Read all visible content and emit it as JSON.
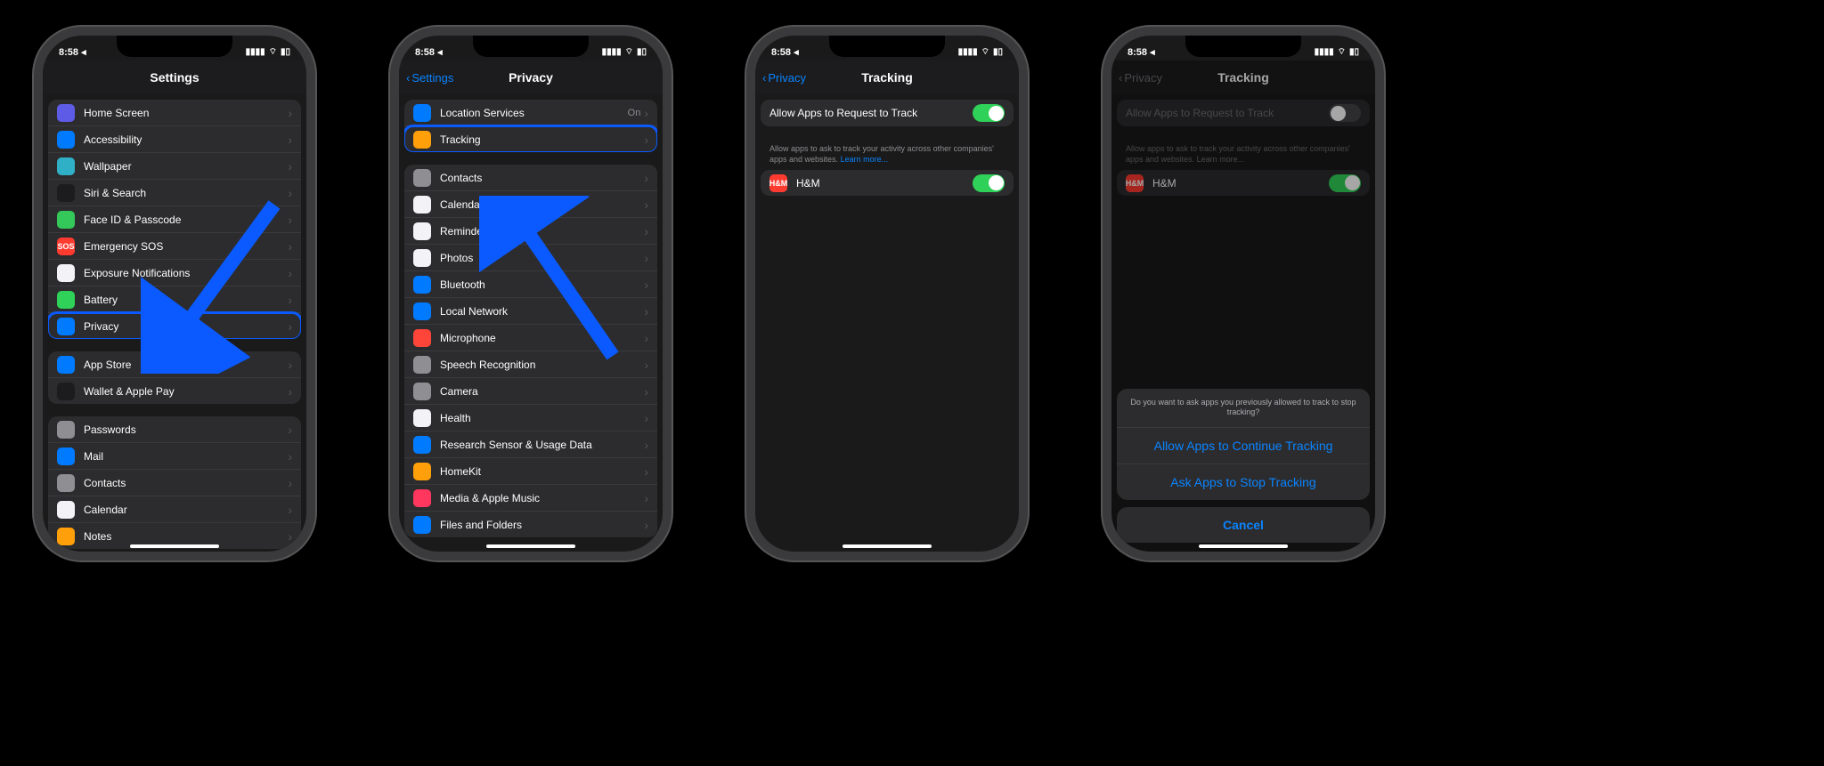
{
  "status": {
    "time": "8:58",
    "indicator": "◂"
  },
  "screen1": {
    "title": "Settings",
    "items": [
      {
        "label": "Home Screen",
        "icon_name": "home-screen-icon",
        "icon_class": "i-purple"
      },
      {
        "label": "Accessibility",
        "icon_name": "accessibility-icon",
        "icon_class": "i-blue2"
      },
      {
        "label": "Wallpaper",
        "icon_name": "wallpaper-icon",
        "icon_class": "i-teal"
      },
      {
        "label": "Siri & Search",
        "icon_name": "siri-icon",
        "icon_class": "i-dark"
      },
      {
        "label": "Face ID & Passcode",
        "icon_name": "faceid-icon",
        "icon_class": "i-green"
      },
      {
        "label": "Emergency SOS",
        "icon_name": "sos-icon",
        "icon_class": "i-red",
        "icon_text": "SOS"
      },
      {
        "label": "Exposure Notifications",
        "icon_name": "exposure-icon",
        "icon_class": "i-white"
      },
      {
        "label": "Battery",
        "icon_name": "battery-icon",
        "icon_class": "i-green2"
      },
      {
        "label": "Privacy",
        "icon_name": "privacy-icon",
        "icon_class": "i-blue2",
        "highlight": true
      }
    ],
    "group2": [
      {
        "label": "App Store",
        "icon_name": "appstore-icon",
        "icon_class": "i-blue2"
      },
      {
        "label": "Wallet & Apple Pay",
        "icon_name": "wallet-icon",
        "icon_class": "i-dark"
      }
    ],
    "group3": [
      {
        "label": "Passwords",
        "icon_name": "passwords-icon",
        "icon_class": "i-gray"
      },
      {
        "label": "Mail",
        "icon_name": "mail-icon",
        "icon_class": "i-blue2"
      },
      {
        "label": "Contacts",
        "icon_name": "contacts-icon",
        "icon_class": "i-gray"
      },
      {
        "label": "Calendar",
        "icon_name": "calendar-icon",
        "icon_class": "i-white"
      },
      {
        "label": "Notes",
        "icon_name": "notes-icon",
        "icon_class": "i-orange"
      }
    ]
  },
  "screen2": {
    "title": "Privacy",
    "back": "Settings",
    "top": [
      {
        "label": "Location Services",
        "icon_name": "location-icon",
        "icon_class": "i-blue2",
        "value": "On"
      },
      {
        "label": "Tracking",
        "icon_name": "tracking-icon",
        "icon_class": "i-orange",
        "highlight": true
      }
    ],
    "items": [
      {
        "label": "Contacts",
        "icon_name": "contacts-icon",
        "icon_class": "i-gray"
      },
      {
        "label": "Calendars",
        "icon_name": "calendars-icon",
        "icon_class": "i-white"
      },
      {
        "label": "Reminders",
        "icon_name": "reminders-icon",
        "icon_class": "i-white"
      },
      {
        "label": "Photos",
        "icon_name": "photos-icon",
        "icon_class": "i-white"
      },
      {
        "label": "Bluetooth",
        "icon_name": "bluetooth-icon",
        "icon_class": "i-blue2"
      },
      {
        "label": "Local Network",
        "icon_name": "network-icon",
        "icon_class": "i-blue2"
      },
      {
        "label": "Microphone",
        "icon_name": "microphone-icon",
        "icon_class": "i-red2"
      },
      {
        "label": "Speech Recognition",
        "icon_name": "speech-icon",
        "icon_class": "i-gray"
      },
      {
        "label": "Camera",
        "icon_name": "camera-icon",
        "icon_class": "i-gray"
      },
      {
        "label": "Health",
        "icon_name": "health-icon",
        "icon_class": "i-white"
      },
      {
        "label": "Research Sensor & Usage Data",
        "icon_name": "research-icon",
        "icon_class": "i-blue2"
      },
      {
        "label": "HomeKit",
        "icon_name": "homekit-icon",
        "icon_class": "i-orange"
      },
      {
        "label": "Media & Apple Music",
        "icon_name": "music-icon",
        "icon_class": "i-pink"
      },
      {
        "label": "Files and Folders",
        "icon_name": "files-icon",
        "icon_class": "i-blue2"
      }
    ]
  },
  "screen3": {
    "title": "Tracking",
    "back": "Privacy",
    "allow_label": "Allow Apps to Request to Track",
    "allow_on": true,
    "footer": "Allow apps to ask to track your activity across other companies' apps and websites. ",
    "learn": "Learn more...",
    "apps": [
      {
        "label": "H&M",
        "icon_name": "hm-icon",
        "icon_class": "i-red",
        "icon_text": "H&M",
        "on": true
      }
    ]
  },
  "screen4": {
    "title": "Tracking",
    "back": "Privacy",
    "allow_label": "Allow Apps to Request to Track",
    "allow_on": false,
    "footer": "Allow apps to ask to track your activity across other companies' apps and websites. ",
    "learn": "Learn more...",
    "apps": [
      {
        "label": "H&M",
        "icon_name": "hm-icon",
        "icon_class": "i-red",
        "icon_text": "H&M",
        "on": true
      }
    ],
    "sheet": {
      "message": "Do you want to ask apps you previously allowed to track to stop tracking?",
      "btn1": "Allow Apps to Continue Tracking",
      "btn2": "Ask Apps to Stop Tracking",
      "cancel": "Cancel"
    }
  }
}
